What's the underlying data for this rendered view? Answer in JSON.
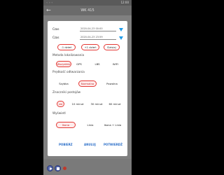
{
  "statusbar": {
    "left": "◦ ◦ ◦",
    "time": "12:00"
  },
  "appbar": {
    "back_glyph": "←",
    "title": "WK 415"
  },
  "dialog": {
    "from_label": "Czas",
    "from_value": "2020-04-23 00:00",
    "to_label": "Czas",
    "to_value": "2020-04-23 23:59",
    "day_minus": "-1 dzień",
    "day_plus": "+1 dzień",
    "today": "Dzisiaj",
    "location_method_label": "Metoda lokalizowania",
    "location_methods": [
      "Wszystkie",
      "GPS",
      "LBS",
      "WIFI"
    ],
    "playback_speed_label": "Prędkość odtwarzania",
    "speeds": [
      "Szybka",
      "Normalna",
      "Powolna"
    ],
    "stop_marker_label": "Znaczniki postojów",
    "stop_markers": [
      "nie",
      "10 minut",
      "30 minut",
      "60 minut"
    ],
    "display_label": "Wyświetl",
    "display_options": [
      "Ikona",
      "Linia",
      "Ikona + Linia"
    ],
    "actions": {
      "download": "POBIERZ",
      "cancel": "ANULUJ",
      "confirm": "POTWIERDŹ"
    }
  },
  "colors": {
    "accent": "#e53935",
    "action": "#2a6ec8",
    "funnel": "#1e9be8"
  }
}
